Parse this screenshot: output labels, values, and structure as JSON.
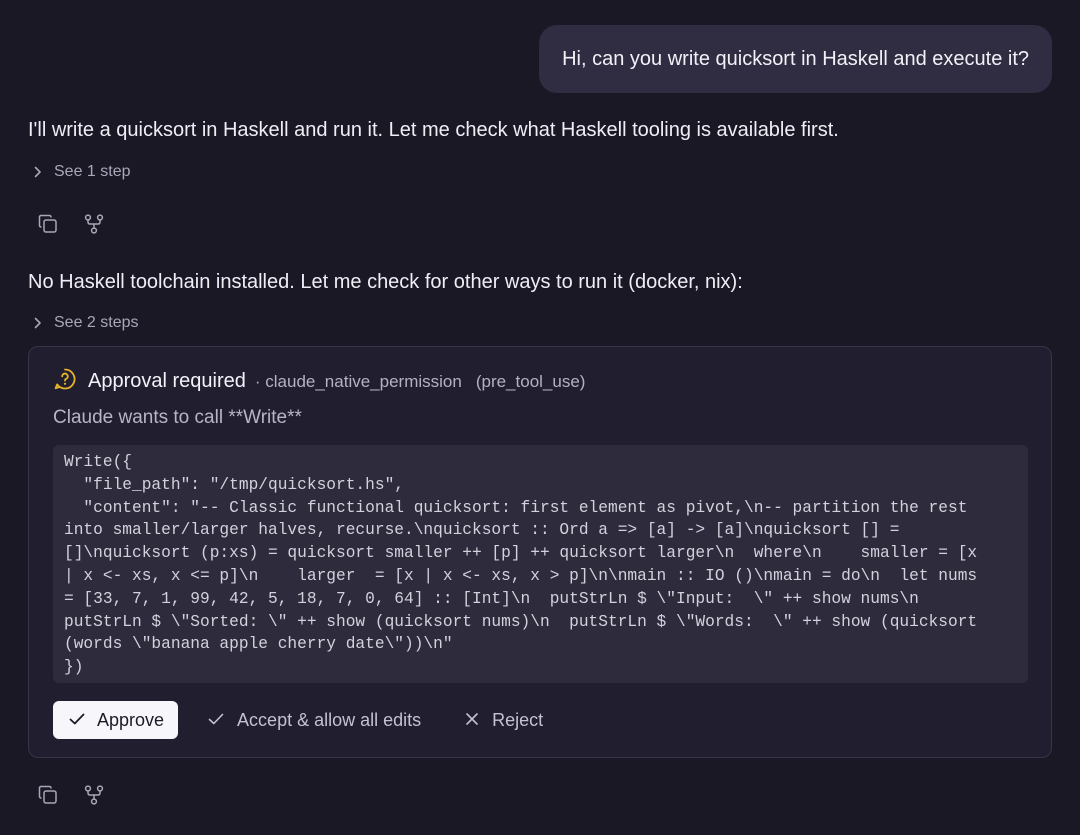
{
  "user_message": "Hi, can you write quicksort in Haskell and execute it?",
  "messages": [
    {
      "text": "I'll write a quicksort in Haskell and run it. Let me check what Haskell tooling is available first.",
      "steps_label": "See 1 step"
    },
    {
      "text": "No Haskell toolchain installed. Let me check for other ways to run it (docker, nix):",
      "steps_label": "See 2 steps"
    }
  ],
  "approval": {
    "title": "Approval required",
    "source": "· claude_native_permission",
    "hook": "(pre_tool_use)",
    "description": "Claude wants to call **Write**",
    "code": "Write({\n  \"file_path\": \"/tmp/quicksort.hs\",\n  \"content\": \"-- Classic functional quicksort: first element as pivot,\\n-- partition the rest\ninto smaller/larger halves, recurse.\\nquicksort :: Ord a => [a] -> [a]\\nquicksort [] =\n[]\\nquicksort (p:xs) = quicksort smaller ++ [p] ++ quicksort larger\\n  where\\n    smaller = [x\n| x <- xs, x <= p]\\n    larger  = [x | x <- xs, x > p]\\n\\nmain :: IO ()\\nmain = do\\n  let nums\n= [33, 7, 1, 99, 42, 5, 18, 7, 0, 64] :: [Int]\\n  putStrLn $ \\\"Input:  \\\" ++ show nums\\n\nputStrLn $ \\\"Sorted: \\\" ++ show (quicksort nums)\\n  putStrLn $ \\\"Words:  \\\" ++ show (quicksort\n(words \\\"banana apple cherry date\\\"))\\n\"\n})",
    "buttons": {
      "approve": "Approve",
      "accept_all": "Accept & allow all edits",
      "reject": "Reject"
    }
  },
  "icons": {
    "copy": "copy-icon",
    "branch": "branch-icon",
    "chevron": "chevron-right-icon",
    "question": "question-circle-icon",
    "check": "check-icon",
    "close": "close-icon"
  },
  "colors": {
    "background": "#1b1826",
    "user_bubble": "#302c42",
    "card": "#211e2f",
    "code_bg": "#2e2b3d",
    "warning_icon": "#e5b42a"
  }
}
